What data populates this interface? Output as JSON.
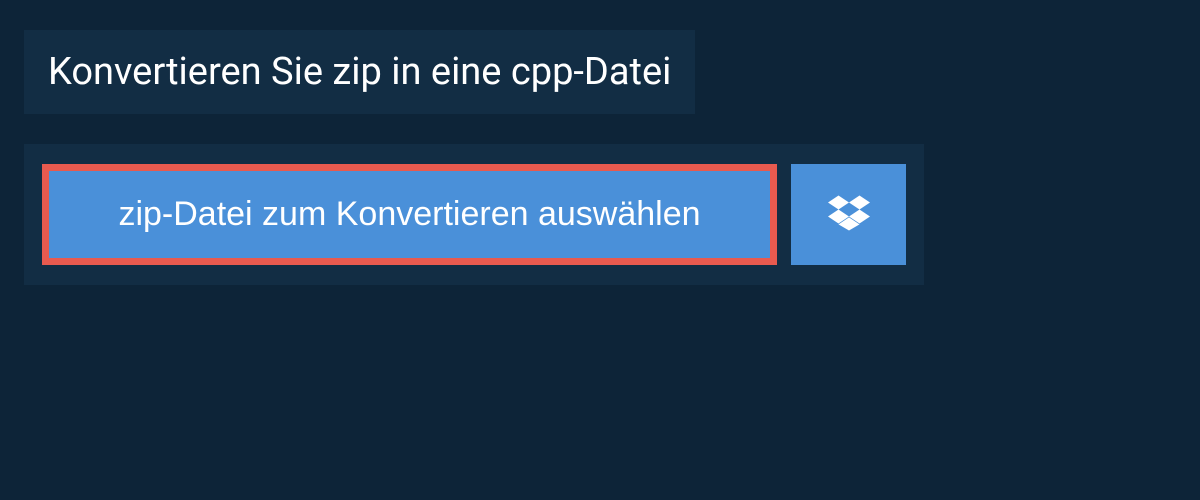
{
  "heading": "Konvertieren Sie zip in eine cpp-Datei",
  "select_button_label": "zip-Datei zum Konvertieren auswählen",
  "colors": {
    "background": "#0d2438",
    "panel": "#122d44",
    "button": "#4a90d9",
    "highlight_border": "#e85a4f"
  }
}
